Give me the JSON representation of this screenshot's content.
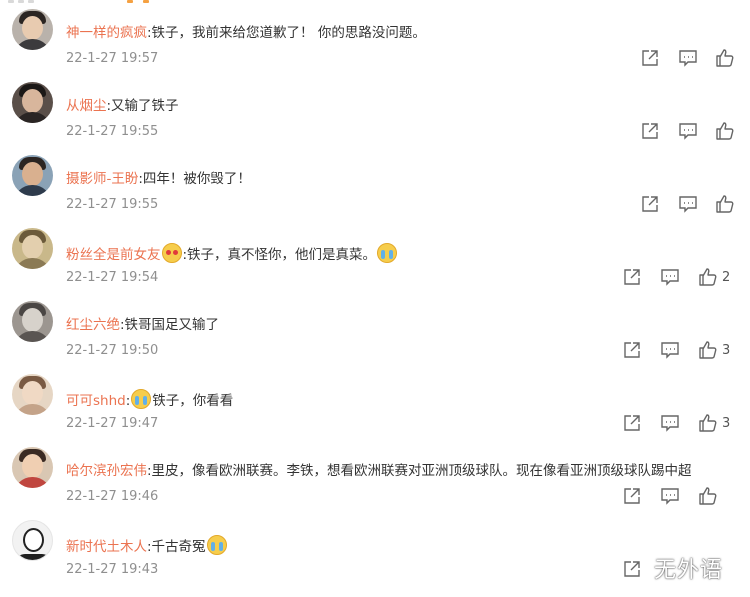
{
  "comments": [
    {
      "user": "神一样的疯疯",
      "text": ":铁子，我前来给您道歉了！ 你的思路没问题。",
      "time": "22-1-27 19:57",
      "likes": ""
    },
    {
      "user": "从烟尘",
      "text": ":又输了铁子",
      "time": "22-1-27 19:55",
      "likes": ""
    },
    {
      "user": "摄影师-王盼",
      "text": ":四年！被你毁了！",
      "time": "22-1-27 19:55",
      "likes": ""
    },
    {
      "user": "粉丝全是前女友",
      "text": ":铁子，真不怪你，他们是真菜。",
      "time": "22-1-27 19:54",
      "likes": "2"
    },
    {
      "user": "红尘六绝",
      "text": ":铁哥国足又输了",
      "time": "22-1-27 19:50",
      "likes": "3"
    },
    {
      "user": "可可shhd",
      "text": ":",
      "text2": "铁子，你看看",
      "time": "22-1-27 19:47",
      "likes": "3"
    },
    {
      "user": "哈尔滨孙宏伟",
      "text": ":里皮，像看欧洲联赛。李铁，想看欧洲联赛对亚洲顶级球队。现在像看亚洲顶级球队踢中超",
      "time": "22-1-27 19:46",
      "likes": ""
    },
    {
      "user": "新时代土木人",
      "text": ":千古奇冤",
      "time": "22-1-27 19:43",
      "likes": ""
    }
  ],
  "icons": {
    "share": "share-icon",
    "reply": "comment-icon",
    "like": "thumbs-up-icon",
    "emoji": "crying-emoji-icon"
  },
  "watermark": "无外语",
  "colors": {
    "username": "#eb7350",
    "text": "#333333",
    "time": "#8f8f8f",
    "icon": "#666666"
  }
}
